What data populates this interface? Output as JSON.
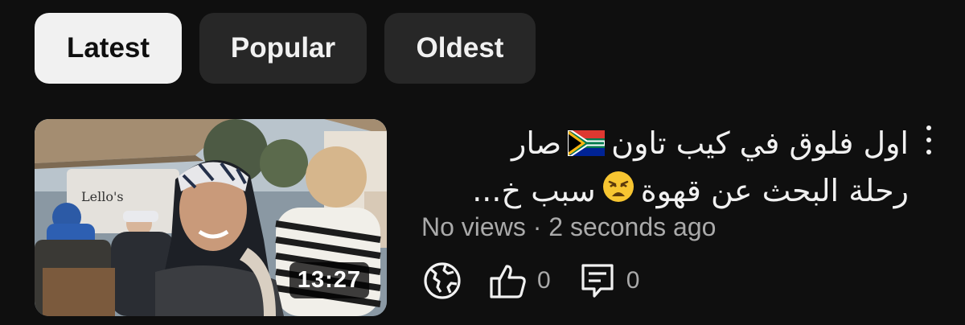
{
  "filters": {
    "latest": "Latest",
    "popular": "Popular",
    "oldest": "Oldest",
    "selected": "Latest"
  },
  "video": {
    "duration": "13:27",
    "title_line1_text": "اول فلوق في كيب تاون",
    "title_line1_tail": "صار",
    "title_line2_text": "رحلة البحث عن قهوة",
    "title_line2_tail": "سبب خ...",
    "flag_icon": "south-africa-flag-emoji",
    "emoji_icon": "weary-face-emoji",
    "views": "No views",
    "separator": "·",
    "age": "2 seconds ago",
    "likes": "0",
    "comments": "0",
    "visibility_icon": "globe-icon",
    "like_icon": "thumbs-up-icon",
    "comment_icon": "comment-icon",
    "more_icon": "more-vertical-icon"
  }
}
